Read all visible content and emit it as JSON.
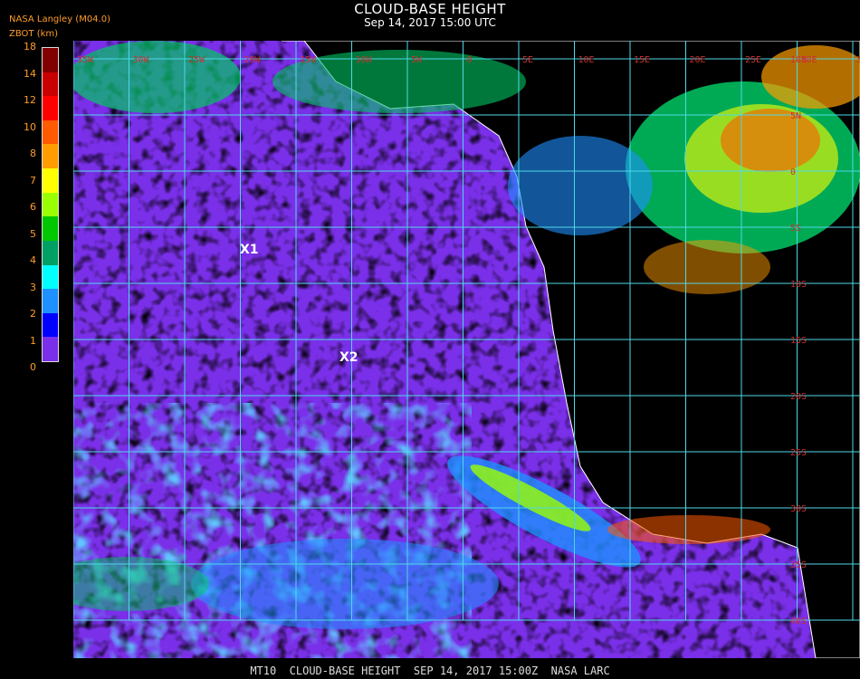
{
  "title": "CLOUD-BASE HEIGHT",
  "subtitle": "Sep 14, 2017 15:00 UTC",
  "source": "NASA Langley (M04.0)",
  "variable": "ZBOT (km)",
  "footer": "MT10  CLOUD-BASE HEIGHT  SEP 14, 2017 15:00Z  NASA LARC",
  "legend": {
    "ticks": [
      "18",
      "14",
      "12",
      "10",
      "8",
      "7",
      "6",
      "5",
      "4",
      "3",
      "2",
      "1",
      "0"
    ],
    "colors": [
      "#800000",
      "#c80000",
      "#ff0000",
      "#ff5a00",
      "#ff9c00",
      "#ffff00",
      "#9aff00",
      "#00c800",
      "#00a064",
      "#00ffff",
      "#1e90ff",
      "#0000ff",
      "#7a2fe8"
    ]
  },
  "map": {
    "background_color": "#7a2fe8",
    "land_color": "#000000",
    "grid_color": "#4fd8e8",
    "label_color": "#c83232",
    "markers": [
      {
        "label": "X1",
        "marker_color": "#ff00ff"
      },
      {
        "label": "X2",
        "marker_color": "#ff00ff"
      }
    ],
    "lat_labels": [
      "10N",
      "5N",
      "0",
      "5S",
      "10S",
      "15S",
      "20S",
      "25S",
      "30S",
      "35S",
      "40S"
    ],
    "lon_labels": [
      "35W",
      "30W",
      "25W",
      "20W",
      "15W",
      "10W",
      "5W",
      "0",
      "5E",
      "10E",
      "15E",
      "20E",
      "25E",
      "30E",
      "35E"
    ]
  }
}
